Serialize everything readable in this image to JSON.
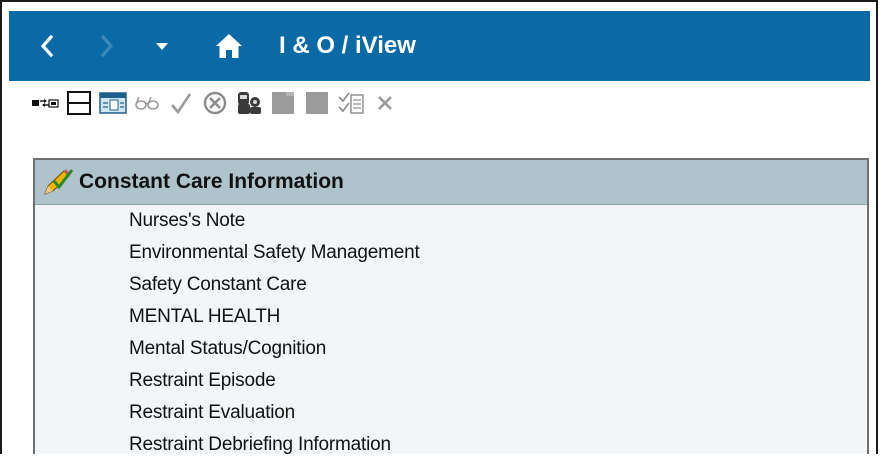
{
  "window": {
    "title": "I & O / iView",
    "titlebar_color": "#0a6aa5"
  },
  "nav": {
    "back_icon": "chevron-left-icon",
    "forward_icon": "chevron-right-icon",
    "dropdown_icon": "caret-down-icon",
    "home_icon": "home-icon"
  },
  "toolbar": {
    "icons": [
      "expand-cells-icon",
      "split-view-icon",
      "table-view-icon",
      "glasses-icon",
      "checkmark-icon",
      "cancel-circle-icon",
      "people-icon",
      "folder-icon",
      "document-icon",
      "result-list-icon",
      "close-x-icon"
    ]
  },
  "section": {
    "title": "Constant Care Information",
    "header_color": "#aec3cc",
    "items": [
      "Nurses's Note",
      "Environmental Safety Management",
      "Safety Constant Care",
      "MENTAL HEALTH",
      "Mental Status/Cognition",
      "Restraint Episode",
      "Restraint Evaluation",
      "Restraint Debriefing Information"
    ]
  }
}
